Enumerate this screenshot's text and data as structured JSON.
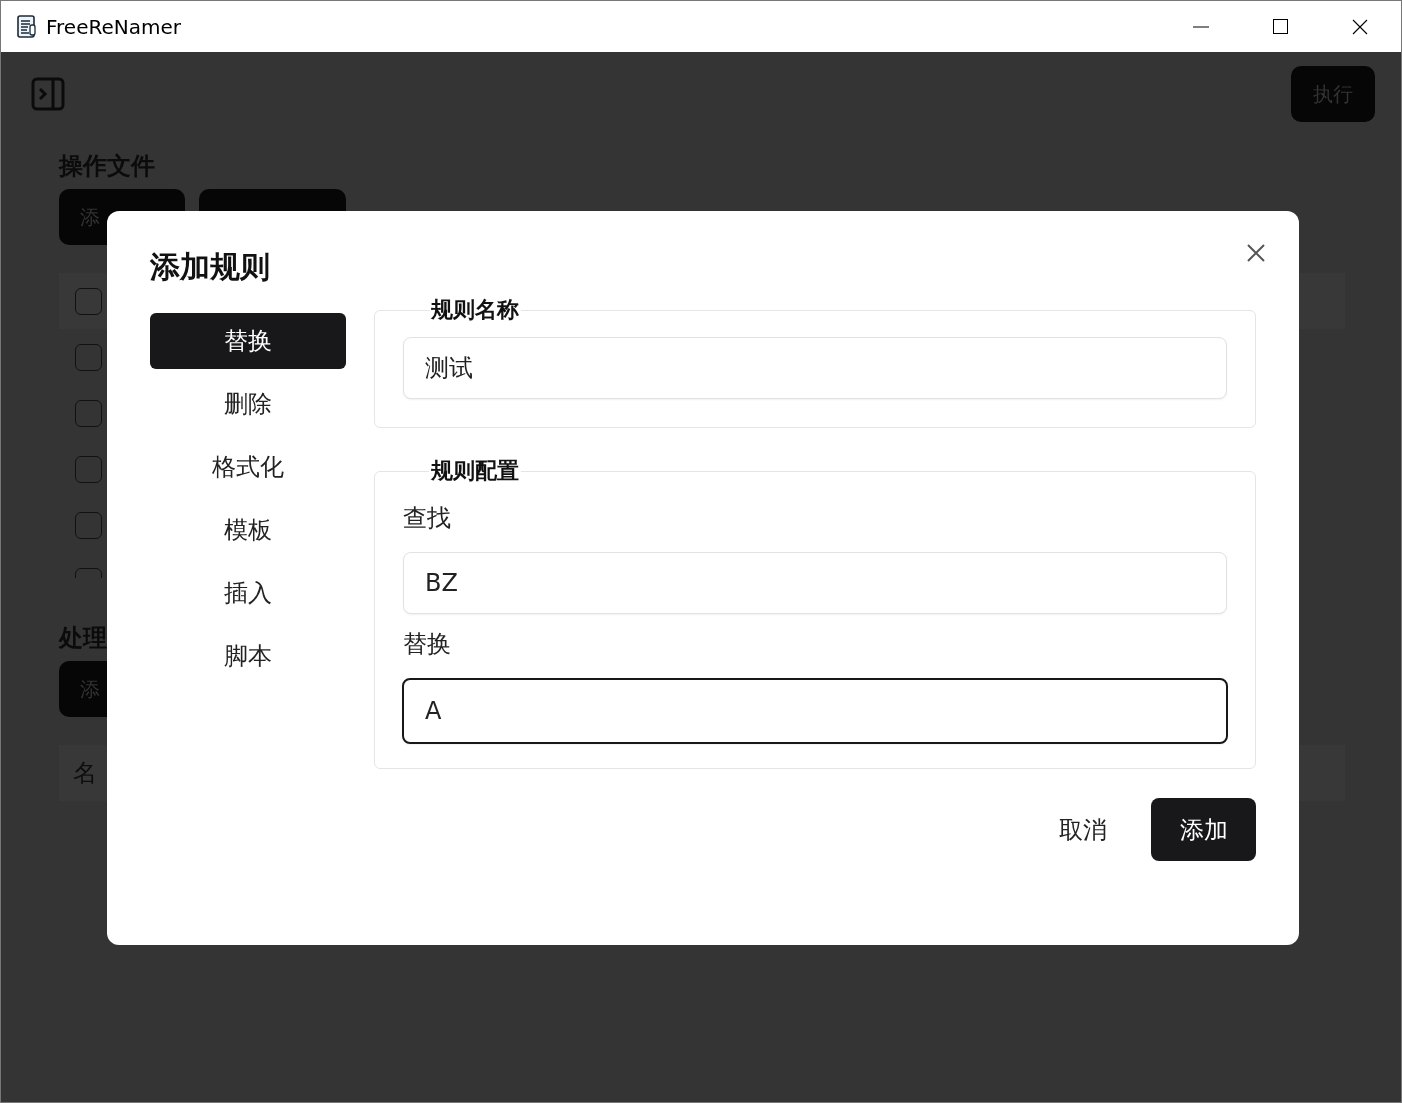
{
  "window": {
    "title": "FreeReNamer"
  },
  "toolbar": {
    "execute_button": "执行"
  },
  "file_section": {
    "title": "操作文件",
    "add_button": "添",
    "rows": [
      {
        "checked": false
      },
      {
        "checked": false
      },
      {
        "checked": false
      },
      {
        "checked": false
      },
      {
        "checked": false
      },
      {
        "checked": false
      }
    ]
  },
  "rule_section": {
    "title": "处理",
    "add_button": "添",
    "table": {
      "column_1": "名"
    }
  },
  "dialog": {
    "title": "添加规则",
    "rule_types": [
      {
        "label": "替换",
        "selected": true
      },
      {
        "label": "删除",
        "selected": false
      },
      {
        "label": "格式化",
        "selected": false
      },
      {
        "label": "模板",
        "selected": false
      },
      {
        "label": "插入",
        "selected": false
      },
      {
        "label": "脚本",
        "selected": false
      }
    ],
    "name_group": {
      "legend": "规则名称",
      "value": "测试"
    },
    "config_group": {
      "legend": "规则配置",
      "fields": [
        {
          "label": "查找",
          "value": "BZ",
          "focused": false
        },
        {
          "label": "替换",
          "value": "A",
          "focused": true
        }
      ]
    },
    "cancel_button": "取消",
    "confirm_button": "添加"
  }
}
